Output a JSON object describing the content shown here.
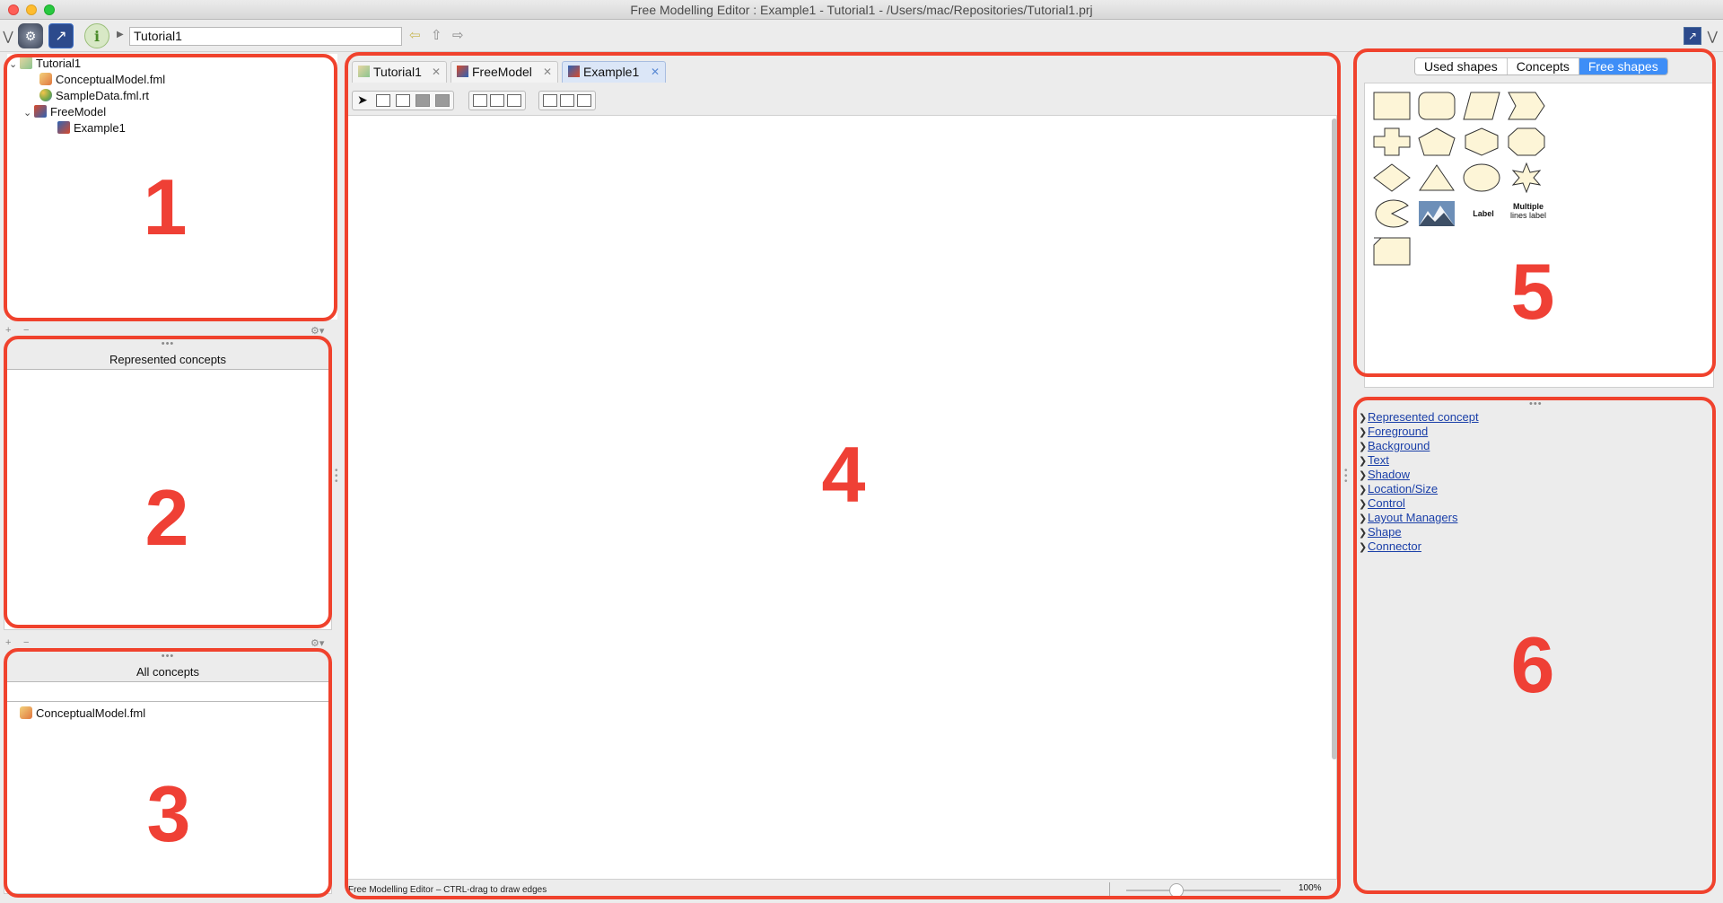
{
  "window": {
    "title": "Free Modelling Editor : Example1 - Tutorial1 - /Users/mac/Repositories/Tutorial1.prj"
  },
  "toolbar": {
    "location_value": "Tutorial1"
  },
  "project_tree": {
    "items": [
      {
        "label": "Tutorial1"
      },
      {
        "label": "ConceptualModel.fml"
      },
      {
        "label": "SampleData.fml.rt"
      },
      {
        "label": "FreeModel"
      },
      {
        "label": "Example1"
      }
    ]
  },
  "represented_concepts": {
    "title": "Represented concepts"
  },
  "all_concepts": {
    "title": "All concepts",
    "items": [
      {
        "label": "ConceptualModel.fml"
      }
    ]
  },
  "editor_tabs": [
    {
      "label": "Tutorial1",
      "active": false
    },
    {
      "label": "FreeModel",
      "active": false
    },
    {
      "label": "Example1",
      "active": true
    }
  ],
  "status": {
    "text": "Free Modelling Editor – CTRL-drag to draw edges",
    "zoom": "100%"
  },
  "shape_palette": {
    "tabs": [
      "Used shapes",
      "Concepts",
      "Free shapes"
    ],
    "active_tab": "Free shapes",
    "shape_names": [
      "rectangle",
      "rounded-rectangle",
      "parallelogram",
      "chevron",
      "plus",
      "pentagon",
      "hexagon",
      "octagon",
      "diamond",
      "triangle",
      "ellipse",
      "star",
      "pie",
      "image",
      "label",
      "multiple-lines-label",
      "note"
    ],
    "label_text": "Label",
    "multi_label_line1": "Multiple",
    "multi_label_line2": "lines label"
  },
  "inspector": {
    "sections": [
      "Represented concept",
      "Foreground",
      "Background",
      "Text",
      "Shadow",
      "Location/Size",
      "Control",
      "Layout Managers",
      "Shape",
      "Connector"
    ]
  },
  "annotations": [
    "1",
    "2",
    "3",
    "4",
    "5",
    "6"
  ],
  "colors": {
    "annotation_red": "#ef4035",
    "shape_fill": "#fdf5d7",
    "active_segment": "#3e8ef7",
    "link_blue": "#1a3fa8"
  }
}
